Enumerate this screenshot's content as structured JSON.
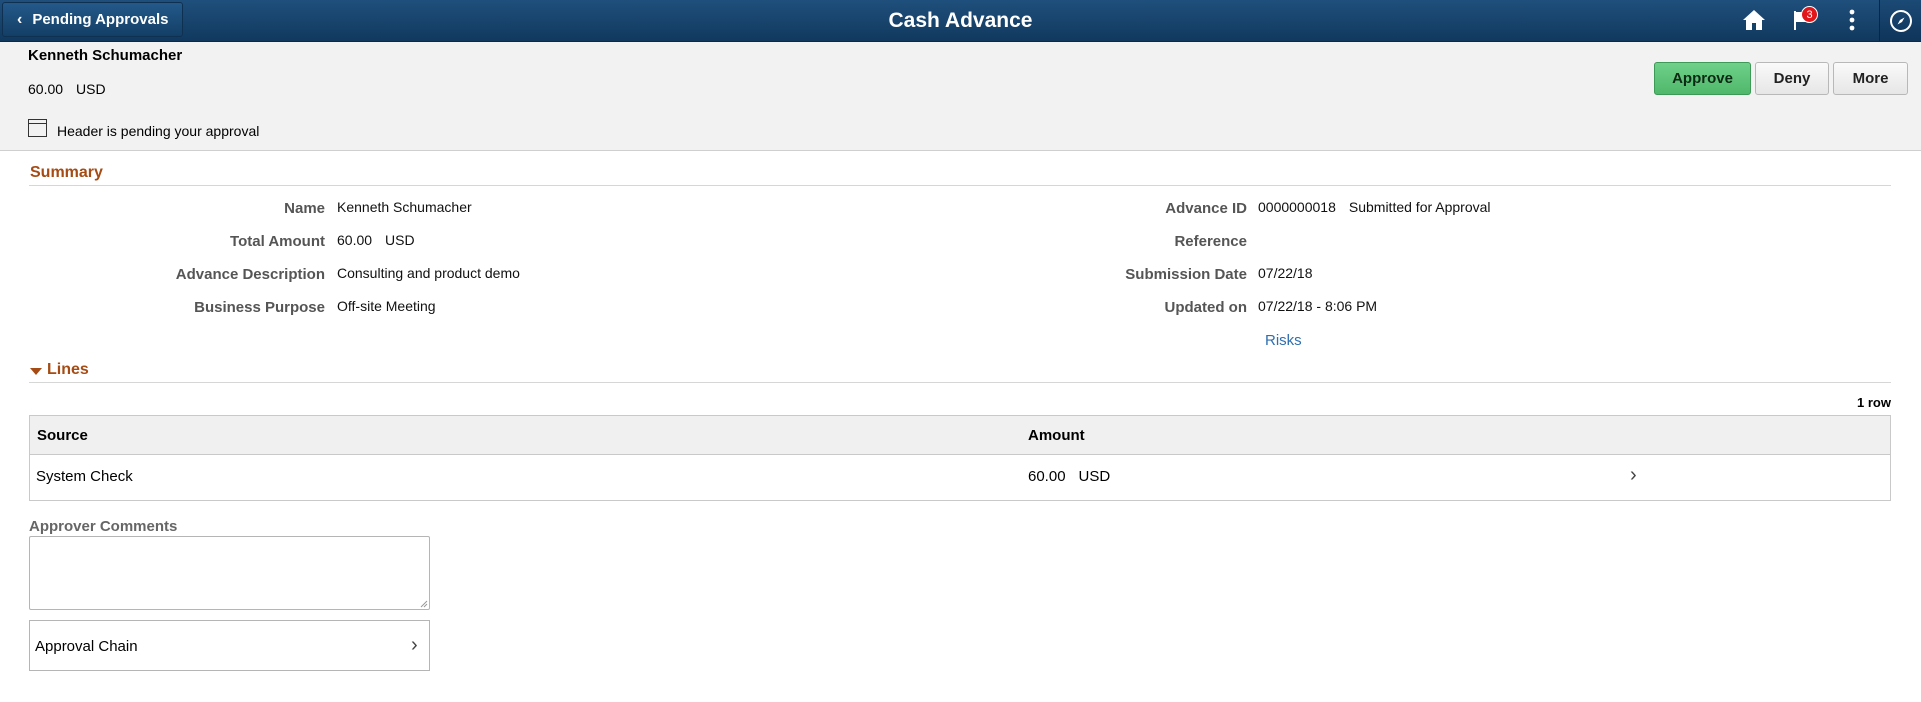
{
  "banner": {
    "back_label": "Pending Approvals",
    "title": "Cash Advance",
    "notification_count": "3",
    "icons": [
      "home-icon",
      "flag-icon",
      "kebab-menu-icon",
      "navbar-compass-icon"
    ]
  },
  "header": {
    "name": "Kenneth Schumacher",
    "amount": "60.00",
    "currency": "USD",
    "pending_text": "Header is pending your approval",
    "actions": {
      "approve": "Approve",
      "deny": "Deny",
      "more": "More"
    }
  },
  "summary": {
    "title": "Summary",
    "labels": {
      "name": "Name",
      "total_amount": "Total Amount",
      "advance_description": "Advance Description",
      "business_purpose": "Business Purpose",
      "advance_id": "Advance ID",
      "reference": "Reference",
      "submission_date": "Submission Date",
      "updated_on": "Updated on"
    },
    "values": {
      "name": "Kenneth Schumacher",
      "total_amount": "60.00",
      "total_currency": "USD",
      "advance_description": "Consulting and product demo",
      "business_purpose": "Off-site Meeting",
      "advance_id": "0000000018",
      "status": "Submitted for Approval",
      "reference": "",
      "submission_date": "07/22/18",
      "updated_on": "07/22/18 - 8:06 PM"
    },
    "risks_link": "Risks"
  },
  "lines": {
    "title": "Lines",
    "row_count": "1 row",
    "columns": [
      "Source",
      "Amount"
    ],
    "rows": [
      {
        "source": "System Check",
        "amount": "60.00",
        "currency": "USD"
      }
    ]
  },
  "comments": {
    "label": "Approver Comments",
    "value": ""
  },
  "approval_chain": {
    "label": "Approval Chain"
  },
  "colors": {
    "banner": "#1a4670",
    "section_title": "#a54b13",
    "approve_button": "#5cc177",
    "link": "#2f6fb0",
    "badge": "#e0161b"
  }
}
